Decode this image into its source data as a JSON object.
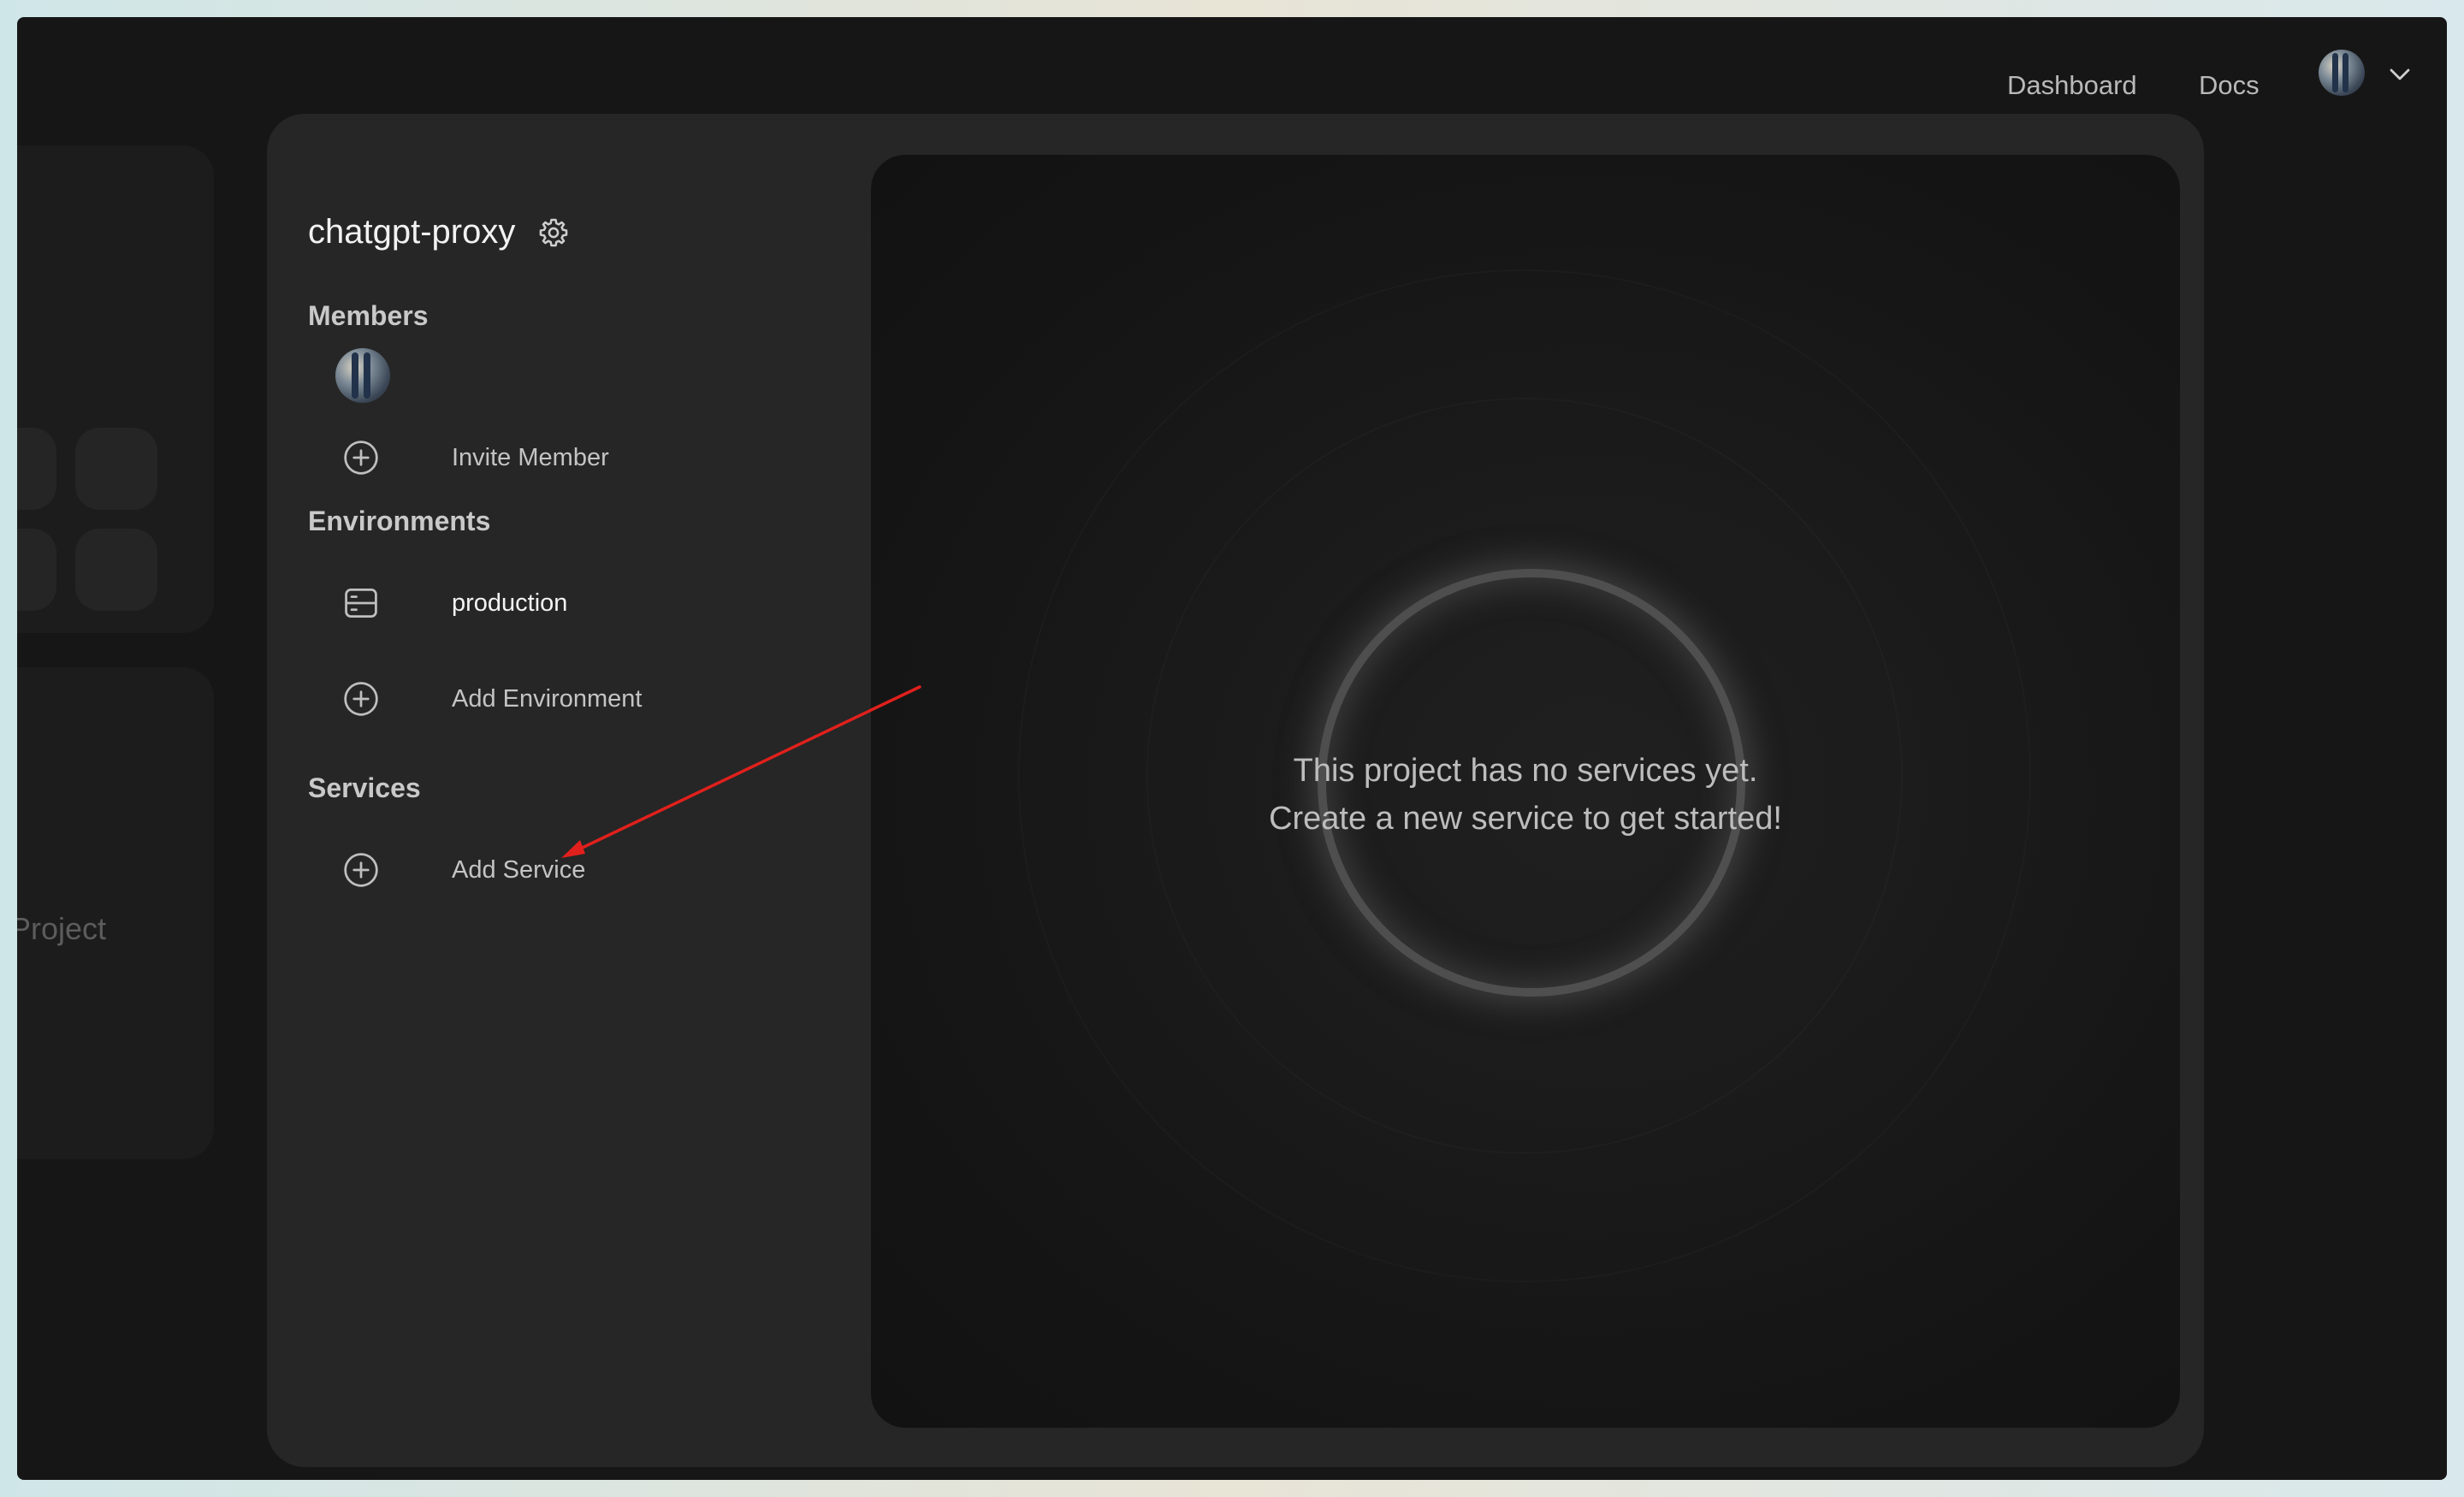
{
  "nav": {
    "dashboard_label": "Dashboard",
    "docs_label": "Docs"
  },
  "background": {
    "project_partial_text": "Project"
  },
  "project": {
    "name": "chatgpt-proxy"
  },
  "members": {
    "heading": "Members",
    "invite_label": "Invite Member"
  },
  "environments": {
    "heading": "Environments",
    "items": [
      {
        "label": "production",
        "icon": "server-icon"
      }
    ],
    "add_label": "Add Environment"
  },
  "services": {
    "heading": "Services",
    "add_label": "Add Service"
  },
  "empty_state": {
    "line1": "This project has no services yet.",
    "line2": "Create a new service to get started!"
  },
  "colors": {
    "window_bg": "#161616",
    "modal_bg": "#262626",
    "annotation_arrow": "#e0201c"
  }
}
